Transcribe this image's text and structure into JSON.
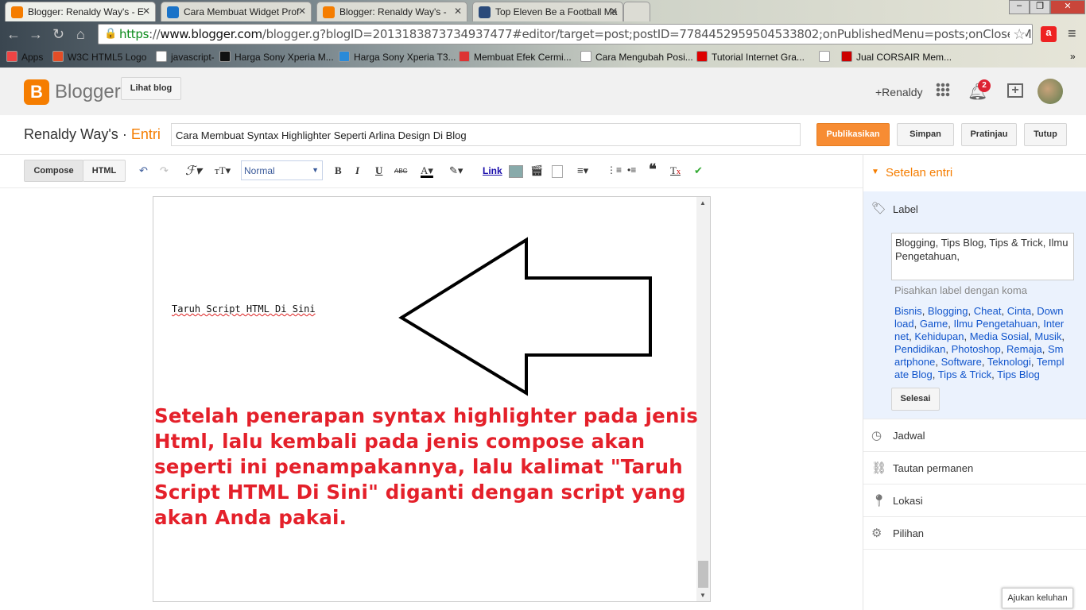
{
  "browser": {
    "tabs": [
      {
        "title": "Blogger: Renaldy Way's - E",
        "icon": "blogger-icon",
        "color": "#f57d00",
        "active": true
      },
      {
        "title": "Cara Membuat Widget Prof",
        "icon": "r-icon",
        "color": "#1a73c8"
      },
      {
        "title": "Blogger: Renaldy Way's -",
        "icon": "blogger-icon",
        "color": "#f57d00"
      },
      {
        "title": "Top Eleven Be a Football Ma",
        "icon": "game-icon",
        "color": "#2a4a7a"
      }
    ],
    "url_scheme": "https",
    "url_sep": "://",
    "url_host": "www.blogger.com",
    "url_rest": "/blogger.g?blogID=2013183873734937477#editor/target=post;postID=7784452959504533802;onPublishedMenu=posts;onClosedMenu=pc",
    "bookmarks": [
      {
        "label": "Apps",
        "color": "#e44"
      },
      {
        "label": "W3C HTML5 Logo",
        "color": "#e44d26"
      },
      {
        "label": "javascript-",
        "color": "#fff"
      },
      {
        "label": "Harga Sony Xperia M...",
        "color": "#111"
      },
      {
        "label": "Harga Sony Xperia T3...",
        "color": "#2a8ad8"
      },
      {
        "label": "Membuat Efek Cermi...",
        "color": "#d33"
      },
      {
        "label": "Cara Mengubah Posi...",
        "color": "#fff"
      },
      {
        "label": "Tutorial Internet Gra...",
        "color": "#d00"
      },
      {
        "label": "",
        "color": "#fff"
      },
      {
        "label": "Jual CORSAIR Mem...",
        "color": "#c00"
      }
    ],
    "overflow": "»"
  },
  "header": {
    "logo_letter": "B",
    "logo_text": "Blogger",
    "view_blog": "Lihat blog",
    "user": "+Renaldy",
    "notifications": "2",
    "accent": "#f57d00"
  },
  "titlebar": {
    "blog_name": "Renaldy Way's",
    "separator": " · ",
    "section": "Entri",
    "post_title": "Cara Membuat Syntax Highlighter Seperti Arlina Design Di Blog",
    "publish": "Publikasikan",
    "save": "Simpan",
    "preview": "Pratinjau",
    "close": "Tutup"
  },
  "toolbar": {
    "compose": "Compose",
    "html": "HTML",
    "font_size": "Normal",
    "link": "Link",
    "bold": "B",
    "italic": "I",
    "underline": "U",
    "strike": "ABC",
    "quote": "❝"
  },
  "editor": {
    "placeholder": "Taruh Script HTML Di Sini",
    "note": "Setelah penerapan syntax highlighter pada jenis Html, lalu kembali pada jenis compose akan seperti ini penampakannya, lalu kalimat \"Taruh Script HTML Di Sini\" diganti dengan script yang akan Anda pakai.",
    "note_color": "#e4202a"
  },
  "sidebar": {
    "title": "Setelan entri",
    "label_heading": "Label",
    "label_value": "Blogging, Tips Blog, Tips & Trick, Ilmu Pengetahuan,",
    "label_hint": "Pisahkan label dengan koma",
    "labels": [
      "Bisnis",
      "Blogging",
      "Cheat",
      "Cinta",
      "Download",
      "Game",
      "Ilmu Pengetahuan",
      "Internet",
      "Kehidupan",
      "Media Sosial",
      "Musik",
      "Pendidikan",
      "Photoshop",
      "Remaja",
      "Smartphone",
      "Software",
      "Teknologi",
      "Template Blog",
      "Tips & Trick",
      "Tips Blog"
    ],
    "done": "Selesai",
    "schedule": "Jadwal",
    "permalink": "Tautan permanen",
    "location": "Lokasi",
    "options": "Pilihan"
  },
  "feedback": "Ajukan keluhan"
}
